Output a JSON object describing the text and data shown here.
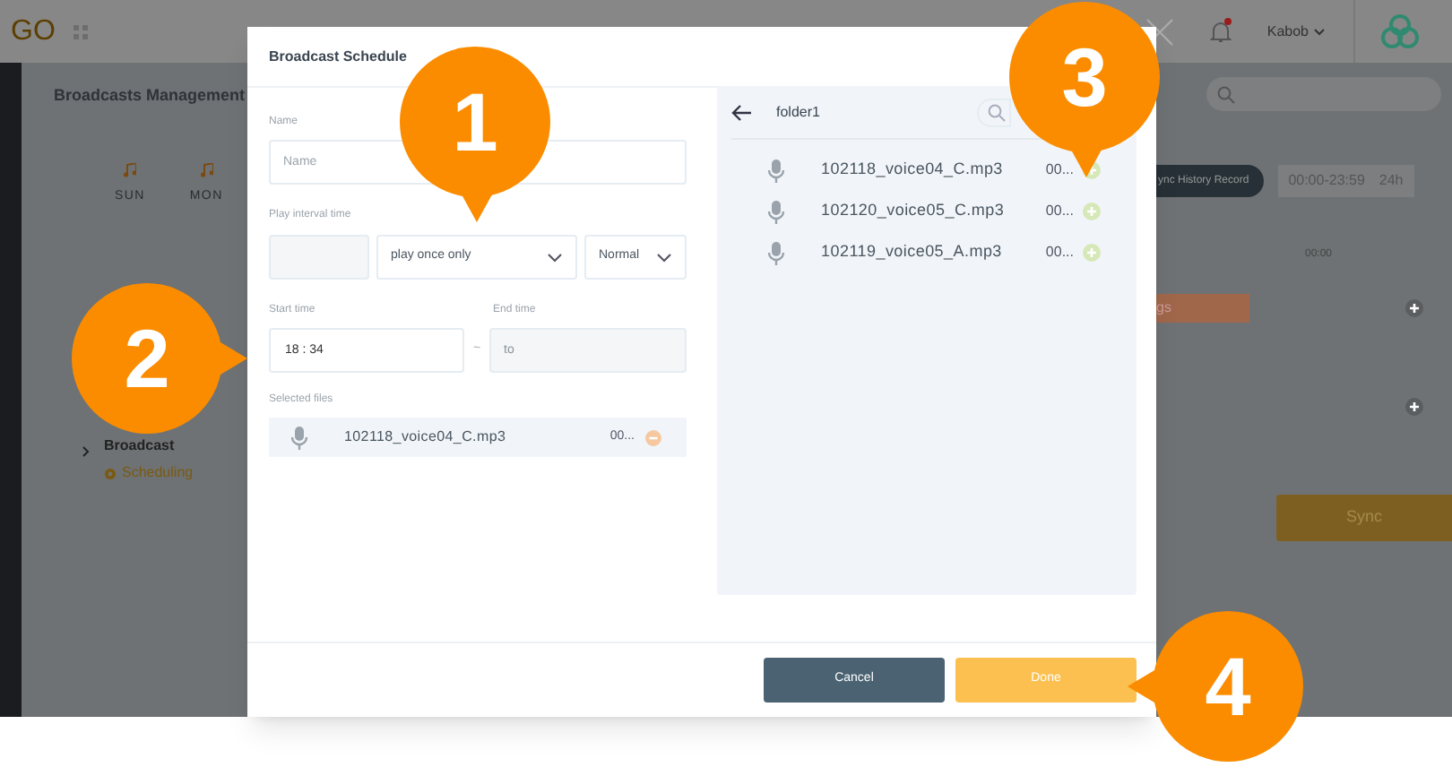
{
  "app": {
    "logo": "GO",
    "user": "Kabob",
    "breadcrumb": "Broadcasts Management",
    "days": [
      "SUN",
      "MON"
    ],
    "tree_item": "Broadcast",
    "status": "Scheduling",
    "sync_history_button": "ync History Record",
    "time_range": "00:00-23:59",
    "period": "24h",
    "timeline_label": "00:00",
    "event_label": "gs",
    "sync_button": "Sync",
    "notification": true
  },
  "dialog": {
    "title": "Broadcast Schedule",
    "name": {
      "label": "Name",
      "placeholder": "Name"
    },
    "interval": {
      "label": "Play interval time",
      "mode": "play once only",
      "speed": "Normal"
    },
    "start": {
      "label": "Start time",
      "value": "18 : 34"
    },
    "separator": "~",
    "end": {
      "label": "End time",
      "placeholder": "to"
    },
    "selected_files": {
      "label": "Selected files",
      "files": [
        {
          "name": "102118_voice04_C.mp3",
          "duration": "00..."
        }
      ]
    },
    "browser": {
      "folder": "folder1",
      "files": [
        {
          "name": "102118_voice04_C.mp3",
          "duration": "00..."
        },
        {
          "name": "102120_voice05_C.mp3",
          "duration": "00..."
        },
        {
          "name": "102119_voice05_A.mp3",
          "duration": "00..."
        }
      ]
    },
    "buttons": [
      {
        "label": "Cancel",
        "kind": "secondary"
      },
      {
        "label": "Done",
        "kind": "primary"
      }
    ]
  },
  "callouts": [
    {
      "label": "1",
      "kind": "down"
    },
    {
      "label": "2",
      "kind": "right"
    },
    {
      "label": "3",
      "kind": "down"
    },
    {
      "label": "4",
      "kind": "left"
    }
  ]
}
